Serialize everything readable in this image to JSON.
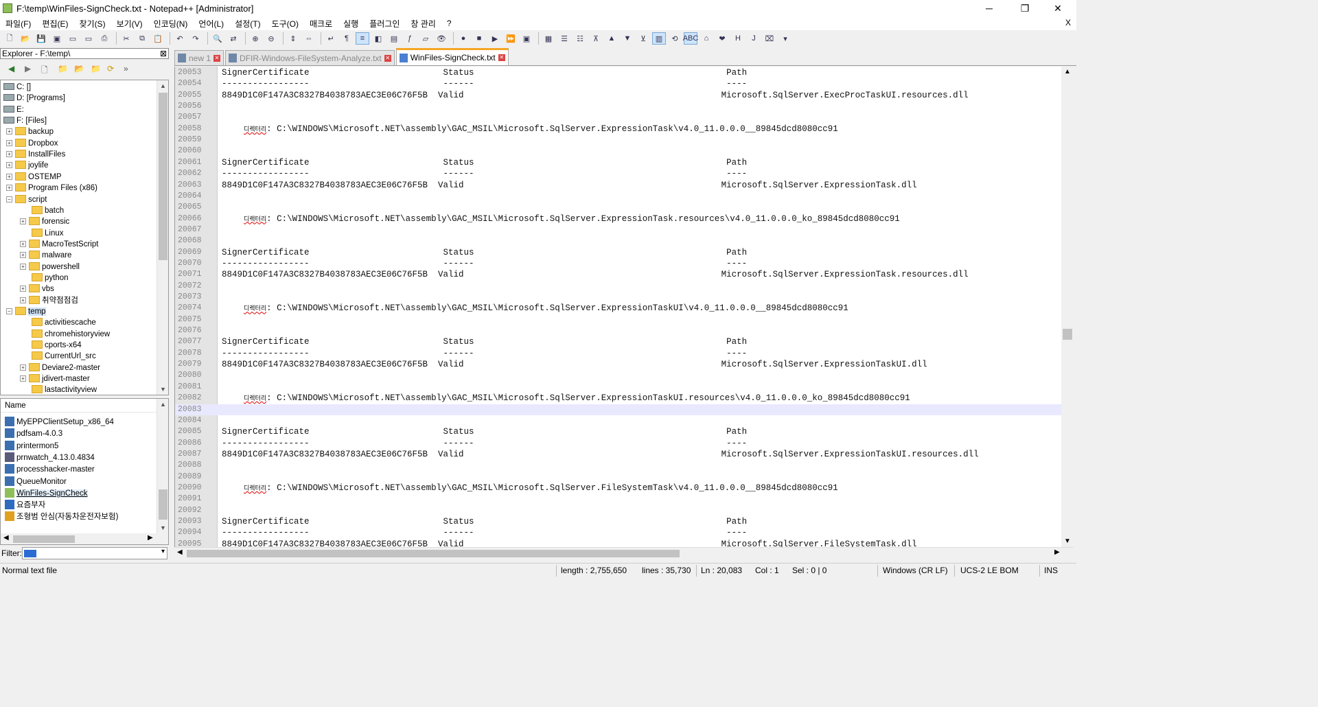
{
  "window": {
    "title": "F:\\temp\\WinFiles-SignCheck.txt - Notepad++ [Administrator]",
    "minimize": "─",
    "restore": "❐",
    "close": "✕"
  },
  "menu": {
    "items": [
      "파일(F)",
      "편집(E)",
      "찾기(S)",
      "보기(V)",
      "인코딩(N)",
      "언어(L)",
      "설정(T)",
      "도구(O)",
      "매크로",
      "실행",
      "플러그인",
      "창 관리",
      "?"
    ],
    "close_doc": "X"
  },
  "explorer": {
    "title": "Explorer - F:\\temp\\",
    "close": "⊠",
    "tree": [
      {
        "label": "C: []",
        "kind": "drive",
        "level": 0,
        "expander": ""
      },
      {
        "label": "D: [Programs]",
        "kind": "drive",
        "level": 0,
        "expander": ""
      },
      {
        "label": "E:",
        "kind": "drive",
        "level": 0,
        "expander": ""
      },
      {
        "label": "F: [Files]",
        "kind": "drive",
        "level": 0,
        "expander": ""
      },
      {
        "label": "backup",
        "kind": "folder",
        "level": 1,
        "expander": "+"
      },
      {
        "label": "Dropbox",
        "kind": "folder",
        "level": 1,
        "expander": "+"
      },
      {
        "label": "InstallFiles",
        "kind": "folder",
        "level": 1,
        "expander": "+"
      },
      {
        "label": "joylife",
        "kind": "folder",
        "level": 1,
        "expander": "+"
      },
      {
        "label": "OSTEMP",
        "kind": "folder",
        "level": 1,
        "expander": "+"
      },
      {
        "label": "Program Files (x86)",
        "kind": "folder",
        "level": 1,
        "expander": "+"
      },
      {
        "label": "script",
        "kind": "folder",
        "level": 1,
        "expander": "−"
      },
      {
        "label": "batch",
        "kind": "folder",
        "level": 2,
        "expander": ""
      },
      {
        "label": "forensic",
        "kind": "folder",
        "level": 2,
        "expander": "+"
      },
      {
        "label": "Linux",
        "kind": "folder",
        "level": 2,
        "expander": ""
      },
      {
        "label": "MacroTestScript",
        "kind": "folder",
        "level": 2,
        "expander": "+"
      },
      {
        "label": "malware",
        "kind": "folder",
        "level": 2,
        "expander": "+"
      },
      {
        "label": "powershell",
        "kind": "folder",
        "level": 2,
        "expander": "+"
      },
      {
        "label": "python",
        "kind": "folder",
        "level": 2,
        "expander": ""
      },
      {
        "label": "vbs",
        "kind": "folder",
        "level": 2,
        "expander": "+"
      },
      {
        "label": "취약점점검",
        "kind": "folder",
        "level": 2,
        "expander": "+"
      },
      {
        "label": "temp",
        "kind": "folder",
        "level": 1,
        "expander": "−",
        "selected": true
      },
      {
        "label": "activitiescache",
        "kind": "folder",
        "level": 2,
        "expander": ""
      },
      {
        "label": "chromehistoryview",
        "kind": "folder",
        "level": 2,
        "expander": ""
      },
      {
        "label": "cports-x64",
        "kind": "folder",
        "level": 2,
        "expander": ""
      },
      {
        "label": "CurrentUrl_src",
        "kind": "folder",
        "level": 2,
        "expander": ""
      },
      {
        "label": "Deviare2-master",
        "kind": "folder",
        "level": 2,
        "expander": "+"
      },
      {
        "label": "jdivert-master",
        "kind": "folder",
        "level": 2,
        "expander": "+"
      },
      {
        "label": "lastactivityview",
        "kind": "folder",
        "level": 2,
        "expander": ""
      }
    ],
    "files_header": "Name",
    "files": [
      {
        "label": "MyEPPClientSetup_x86_64",
        "icon_color": "#3c6fb0"
      },
      {
        "label": "pdfsam-4.0.3",
        "icon_color": "#3c6fb0"
      },
      {
        "label": "printermon5",
        "icon_color": "#3c6fb0"
      },
      {
        "label": "prnwatch_4.13.0.4834",
        "icon_color": "#5a5a7a"
      },
      {
        "label": "processhacker-master",
        "icon_color": "#3c6fb0"
      },
      {
        "label": "QueueMonitor",
        "icon_color": "#3c6fb0"
      },
      {
        "label": "WinFiles-SignCheck",
        "icon_color": "#8fbf5a",
        "selected": true
      },
      {
        "label": "요즘부자",
        "icon_color": "#2e6bbf"
      },
      {
        "label": "조형범 안심(자동차운전자보험)",
        "icon_color": "#e0a020"
      }
    ],
    "filter_label": "Filter:"
  },
  "tabs": [
    {
      "label": "new 1",
      "active": false
    },
    {
      "label": "DFIR-Windows-FileSystem-Analyze.txt",
      "active": false
    },
    {
      "label": "WinFiles-SignCheck.txt",
      "active": true
    }
  ],
  "editor": {
    "current_line": "20083",
    "lines": [
      {
        "num": "20053",
        "text": "SignerCertificate                          Status                                                 Path"
      },
      {
        "num": "20054",
        "text": "-----------------                          ------                                                 ----"
      },
      {
        "num": "20055",
        "text": "8849D1C0F147A3C8327B4038783AEC3E06C76F5B  Valid                                                  Microsoft.SqlServer.ExecProcTaskUI.resources.dll"
      },
      {
        "num": "20056",
        "text": ""
      },
      {
        "num": "20057",
        "text": ""
      },
      {
        "num": "20058",
        "ko": "디렉터리",
        "text": ": C:\\WINDOWS\\Microsoft.NET\\assembly\\GAC_MSIL\\Microsoft.SqlServer.ExpressionTask\\v4.0_11.0.0.0__89845dcd8080cc91"
      },
      {
        "num": "20059",
        "text": ""
      },
      {
        "num": "20060",
        "text": ""
      },
      {
        "num": "20061",
        "text": "SignerCertificate                          Status                                                 Path"
      },
      {
        "num": "20062",
        "text": "-----------------                          ------                                                 ----"
      },
      {
        "num": "20063",
        "text": "8849D1C0F147A3C8327B4038783AEC3E06C76F5B  Valid                                                  Microsoft.SqlServer.ExpressionTask.dll"
      },
      {
        "num": "20064",
        "text": ""
      },
      {
        "num": "20065",
        "text": ""
      },
      {
        "num": "20066",
        "ko": "디렉터리",
        "text": ": C:\\WINDOWS\\Microsoft.NET\\assembly\\GAC_MSIL\\Microsoft.SqlServer.ExpressionTask.resources\\v4.0_11.0.0.0_ko_89845dcd8080cc91"
      },
      {
        "num": "20067",
        "text": ""
      },
      {
        "num": "20068",
        "text": ""
      },
      {
        "num": "20069",
        "text": "SignerCertificate                          Status                                                 Path"
      },
      {
        "num": "20070",
        "text": "-----------------                          ------                                                 ----"
      },
      {
        "num": "20071",
        "text": "8849D1C0F147A3C8327B4038783AEC3E06C76F5B  Valid                                                  Microsoft.SqlServer.ExpressionTask.resources.dll"
      },
      {
        "num": "20072",
        "text": ""
      },
      {
        "num": "20073",
        "text": ""
      },
      {
        "num": "20074",
        "ko": "디렉터리",
        "text": ": C:\\WINDOWS\\Microsoft.NET\\assembly\\GAC_MSIL\\Microsoft.SqlServer.ExpressionTaskUI\\v4.0_11.0.0.0__89845dcd8080cc91"
      },
      {
        "num": "20075",
        "text": ""
      },
      {
        "num": "20076",
        "text": ""
      },
      {
        "num": "20077",
        "text": "SignerCertificate                          Status                                                 Path"
      },
      {
        "num": "20078",
        "text": "-----------------                          ------                                                 ----"
      },
      {
        "num": "20079",
        "text": "8849D1C0F147A3C8327B4038783AEC3E06C76F5B  Valid                                                  Microsoft.SqlServer.ExpressionTaskUI.dll"
      },
      {
        "num": "20080",
        "text": ""
      },
      {
        "num": "20081",
        "text": ""
      },
      {
        "num": "20082",
        "ko": "디렉터리",
        "text": ": C:\\WINDOWS\\Microsoft.NET\\assembly\\GAC_MSIL\\Microsoft.SqlServer.ExpressionTaskUI.resources\\v4.0_11.0.0.0_ko_89845dcd8080cc91"
      },
      {
        "num": "20083",
        "text": ""
      },
      {
        "num": "20084",
        "text": ""
      },
      {
        "num": "20085",
        "text": "SignerCertificate                          Status                                                 Path"
      },
      {
        "num": "20086",
        "text": "-----------------                          ------                                                 ----"
      },
      {
        "num": "20087",
        "text": "8849D1C0F147A3C8327B4038783AEC3E06C76F5B  Valid                                                  Microsoft.SqlServer.ExpressionTaskUI.resources.dll"
      },
      {
        "num": "20088",
        "text": ""
      },
      {
        "num": "20089",
        "text": ""
      },
      {
        "num": "20090",
        "ko": "디렉터리",
        "text": ": C:\\WINDOWS\\Microsoft.NET\\assembly\\GAC_MSIL\\Microsoft.SqlServer.FileSystemTask\\v4.0_11.0.0.0__89845dcd8080cc91"
      },
      {
        "num": "20091",
        "text": ""
      },
      {
        "num": "20092",
        "text": ""
      },
      {
        "num": "20093",
        "text": "SignerCertificate                          Status                                                 Path"
      },
      {
        "num": "20094",
        "text": "-----------------                          ------                                                 ----"
      },
      {
        "num": "20095",
        "text": "8849D1C0F147A3C8327B4038783AEC3E06C76F5B  Valid                                                  Microsoft.SqlServer.FileSystemTask.dll"
      }
    ]
  },
  "status": {
    "type": "Normal text file",
    "length": "length : 2,755,650",
    "lines": "lines : 35,730",
    "ln": "Ln : 20,083",
    "col": "Col : 1",
    "sel": "Sel : 0 | 0",
    "eol": "Windows (CR LF)",
    "encoding": "UCS-2 LE BOM",
    "mode": "INS"
  }
}
